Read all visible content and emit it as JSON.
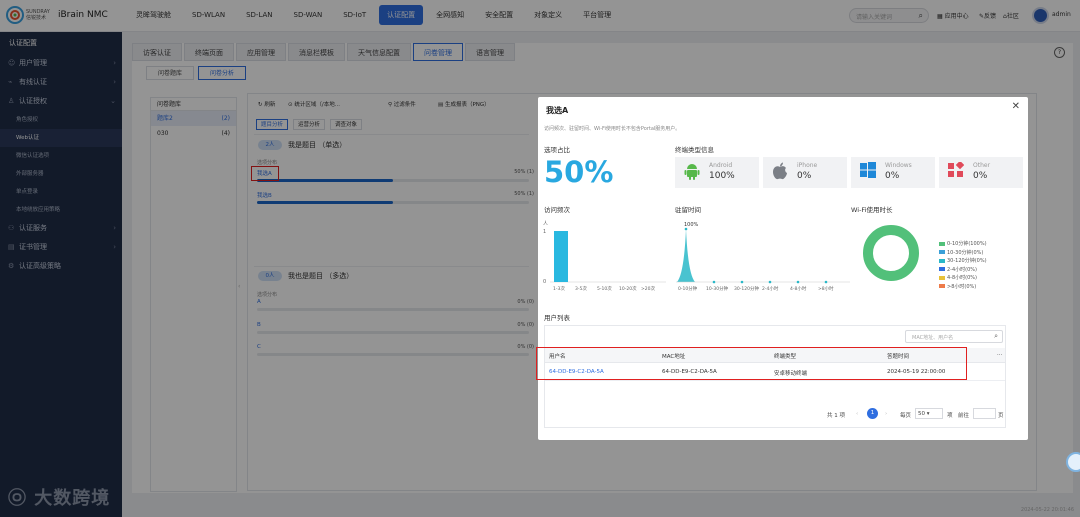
{
  "header": {
    "brand_cn": "SUNDRAY 信锐技术",
    "brand": "iBrain NMC",
    "nav": [
      "灵眸驾驶舱",
      "SD-WLAN",
      "SD-LAN",
      "SD-WAN",
      "SD-IoT",
      "认证配置",
      "全网感知",
      "安全配置",
      "对象定义",
      "平台管理"
    ],
    "active_nav": "认证配置",
    "search_placeholder": "请输入关键词",
    "links": [
      "应用中心",
      "反馈",
      "社区"
    ],
    "user": "admin"
  },
  "sidebar": {
    "title": "认证配置",
    "items": [
      {
        "label": "用户管理"
      },
      {
        "label": "有线认证"
      },
      {
        "label": "认证授权"
      }
    ],
    "subitems": [
      "角色授权",
      "Web认证",
      "微信认证选项",
      "外部服务器",
      "单点登录",
      "本地绕放应用策略"
    ],
    "active_sub": "Web认证",
    "items2": [
      {
        "label": "认证服务"
      },
      {
        "label": "证书管理"
      },
      {
        "label": "认证高级策略"
      }
    ],
    "watermark": "大数跨境"
  },
  "content": {
    "tabs": [
      "访客认证",
      "终端页面",
      "应用管理",
      "消息栏模板",
      "天气信息配置",
      "问卷管理",
      "语言管理"
    ],
    "active_tab": "问卷管理",
    "subtabs": [
      "问卷题库",
      "问卷分析"
    ],
    "active_subtab": "问卷分析",
    "bank": {
      "header": "问卷题库",
      "rows": [
        {
          "name": "题库2",
          "count": "(2)"
        },
        {
          "name": "030",
          "count": "(4)"
        }
      ]
    },
    "toolbar": [
      "刷新",
      "统计区域（/本地...",
      "过滤条件",
      "生成报表（PNG）"
    ],
    "filter_tabs": [
      "题目分析",
      "运营分析",
      "调查对象"
    ],
    "q1": {
      "badge": "2人",
      "title": "我是题目 （单选）",
      "sub": "选项分布",
      "options": [
        {
          "label": "我选A",
          "pct": "50% (1)",
          "value": 0.5
        },
        {
          "label": "我选B",
          "pct": "50% (1)",
          "value": 0.5
        }
      ]
    },
    "q2": {
      "badge": "0人",
      "title": "我也是题目 （多选）",
      "sub": "选项分布",
      "options": [
        {
          "label": "A",
          "pct": "0% (0)",
          "value": 0
        },
        {
          "label": "B",
          "pct": "0% (0)",
          "value": 0
        },
        {
          "label": "C",
          "pct": "0% (0)",
          "value": 0
        }
      ]
    }
  },
  "modal": {
    "title": "我选A",
    "desc": "访问频次、驻留时间、Wi-Fi使用时长不包含Portal服务用户。",
    "option_ratio_label": "选项占比",
    "option_ratio": "50%",
    "terminal_label": "终端类型信息",
    "devices": [
      {
        "name": "Android",
        "pct": "100%",
        "color": "#57b84a",
        "icon": "android-icon"
      },
      {
        "name": "iPhone",
        "pct": "0%",
        "color": "#7b7f86",
        "icon": "apple-icon"
      },
      {
        "name": "Windows",
        "pct": "0%",
        "color": "#1e88d8",
        "icon": "windows-icon"
      },
      {
        "name": "Other",
        "pct": "0%",
        "color": "#e04a5a",
        "icon": "other-icon"
      }
    ],
    "visit_freq": {
      "title": "访问频次",
      "ylabel": "人",
      "yticks": [
        "1",
        "0"
      ],
      "xticks": [
        "1-3次",
        "3-5次",
        "5-10次",
        "10-20次",
        ">20次"
      ],
      "values": [
        1,
        0,
        0,
        0,
        0
      ]
    },
    "dwell": {
      "title": "驻留时间",
      "peak_label": "100%",
      "xticks": [
        "0-10分钟",
        "10-30分钟",
        "30-120分钟",
        "2-4小时",
        "4-8小时",
        ">8小时"
      ],
      "values": [
        100,
        0,
        0,
        0,
        0,
        0
      ]
    },
    "wifi": {
      "title": "Wi-Fi使用时长",
      "legend": [
        {
          "label": "0-10分钟(100%)",
          "color": "#52c07a"
        },
        {
          "label": "10-30分钟(0%)",
          "color": "#3aa0d8"
        },
        {
          "label": "30-120分钟(0%)",
          "color": "#29b8c8"
        },
        {
          "label": "2-4小时(0%)",
          "color": "#2f6ee0"
        },
        {
          "label": "4-8小时(0%)",
          "color": "#e8c23a"
        },
        {
          "label": ">8小时(0%)",
          "color": "#ee7b4a"
        }
      ]
    },
    "user_list": {
      "title": "用户列表",
      "search_placeholder": "MAC地址、用户名",
      "columns": [
        "用户名",
        "MAC地址",
        "终端类型",
        "答题时间"
      ],
      "rows": [
        [
          "64-DD-E9-C2-DA-5A",
          "64-DD-E9-C2-DA-5A",
          "安卓移动终端",
          "2024-05-19 22:00:00"
        ]
      ],
      "total": "共 1 项",
      "page": "1",
      "per_page_label": "每页",
      "per_page": "50",
      "unit": "项",
      "goto": "前往",
      "goto_unit": "页"
    }
  },
  "status_time": "2024-05-22 20:01:46"
}
